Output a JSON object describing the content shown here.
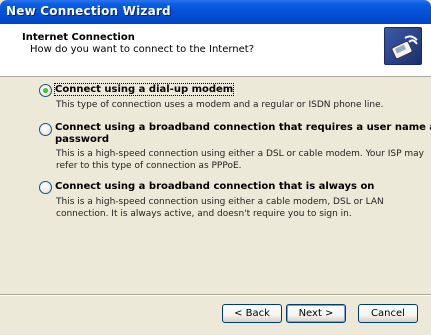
{
  "window": {
    "title": "New Connection Wizard"
  },
  "header": {
    "title": "Internet Connection",
    "subtitle": "How do you want to connect to the Internet?",
    "icon": "phone-connection-icon"
  },
  "options": [
    {
      "label": "Connect using a dial-up modem",
      "checked": true,
      "description": "This type of connection uses a modem and a regular or ISDN phone line."
    },
    {
      "label_line1": "Connect using a broadband connection that requires a user name and",
      "label_line2": "password",
      "checked": false,
      "description_line1": "This is a high-speed connection using either a DSL or cable modem. Your ISP may",
      "description_line2": "refer to this type of connection as PPPoE."
    },
    {
      "label": "Connect using a broadband connection that is always on",
      "checked": false,
      "description_line1": "This is a high-speed connection using either a cable modem, DSL or LAN",
      "description_line2": "connection. It is always active, and doesn't require you to sign in."
    }
  ],
  "buttons": {
    "back": "< Back",
    "next": "Next >",
    "cancel": "Cancel"
  }
}
